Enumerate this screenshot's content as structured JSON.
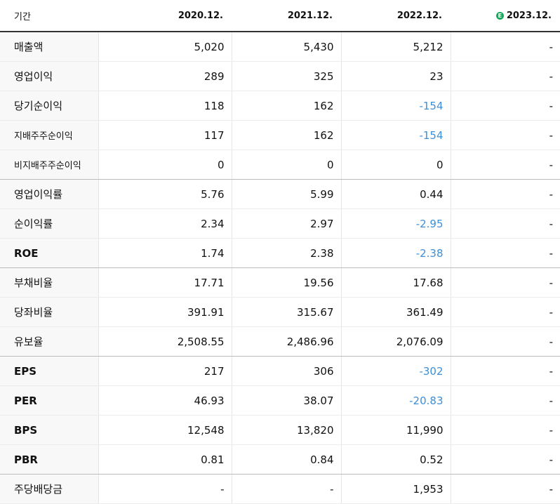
{
  "header": {
    "period_label": "기간",
    "columns": [
      "2020.12.",
      "2021.12.",
      "2022.12.",
      "2023.12."
    ],
    "estimate_badge": "E"
  },
  "rows": [
    {
      "label": "매출액",
      "values": [
        "5,020",
        "5,430",
        "5,212",
        "-"
      ]
    },
    {
      "label": "영업이익",
      "values": [
        "289",
        "325",
        "23",
        "-"
      ]
    },
    {
      "label": "당기순이익",
      "values": [
        "118",
        "162",
        "-154",
        "-"
      ]
    },
    {
      "label": "지배주주순이익",
      "values": [
        "117",
        "162",
        "-154",
        "-"
      ]
    },
    {
      "label": "비지배주주순이익",
      "values": [
        "0",
        "0",
        "0",
        "-"
      ]
    },
    {
      "label": "영업이익률",
      "values": [
        "5.76",
        "5.99",
        "0.44",
        "-"
      ]
    },
    {
      "label": "순이익률",
      "values": [
        "2.34",
        "2.97",
        "-2.95",
        "-"
      ]
    },
    {
      "label": "ROE",
      "values": [
        "1.74",
        "2.38",
        "-2.38",
        "-"
      ]
    },
    {
      "label": "부채비율",
      "values": [
        "17.71",
        "19.56",
        "17.68",
        "-"
      ]
    },
    {
      "label": "당좌비율",
      "values": [
        "391.91",
        "315.67",
        "361.49",
        "-"
      ]
    },
    {
      "label": "유보율",
      "values": [
        "2,508.55",
        "2,486.96",
        "2,076.09",
        "-"
      ]
    },
    {
      "label": "EPS",
      "values": [
        "217",
        "306",
        "-302",
        "-"
      ]
    },
    {
      "label": "PER",
      "values": [
        "46.93",
        "38.07",
        "-20.83",
        "-"
      ]
    },
    {
      "label": "BPS",
      "values": [
        "12,548",
        "13,820",
        "11,990",
        "-"
      ]
    },
    {
      "label": "PBR",
      "values": [
        "0.81",
        "0.84",
        "0.52",
        "-"
      ]
    },
    {
      "label": "주당배당금",
      "values": [
        "-",
        "-",
        "1,953",
        "-"
      ]
    }
  ],
  "colors": {
    "negative": "#3d8fd9",
    "estimate_badge": "#19a75a"
  }
}
